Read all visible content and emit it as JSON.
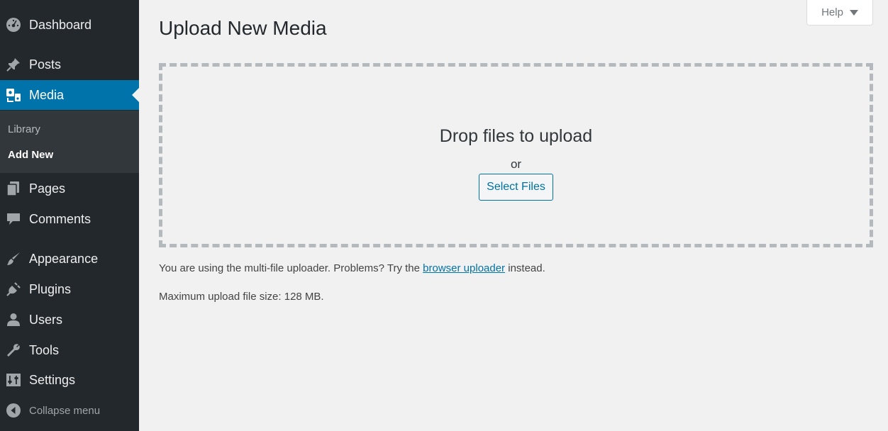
{
  "sidebar": {
    "items": [
      {
        "label": "Dashboard",
        "icon": "dashboard-icon"
      },
      {
        "label": "Posts",
        "icon": "pushpin-icon"
      },
      {
        "label": "Media",
        "icon": "media-icon"
      },
      {
        "label": "Pages",
        "icon": "pages-icon"
      },
      {
        "label": "Comments",
        "icon": "comment-icon"
      },
      {
        "label": "Appearance",
        "icon": "paintbrush-icon"
      },
      {
        "label": "Plugins",
        "icon": "plug-icon"
      },
      {
        "label": "Users",
        "icon": "user-icon"
      },
      {
        "label": "Tools",
        "icon": "wrench-icon"
      },
      {
        "label": "Settings",
        "icon": "settings-sliders-icon"
      }
    ],
    "submenu": [
      {
        "label": "Library"
      },
      {
        "label": "Add New"
      }
    ],
    "collapse_label": "Collapse menu",
    "current": "Media",
    "current_sub": "Add New"
  },
  "help_tab": {
    "label": "Help"
  },
  "main": {
    "title": "Upload New Media",
    "drop_area": {
      "instructions": "Drop files to upload",
      "or": "or",
      "button": "Select Files"
    },
    "notes": {
      "uploader_prefix": "You are using the multi-file uploader. Problems? Try the ",
      "uploader_link": "browser uploader",
      "uploader_suffix": " instead.",
      "max_size": "Maximum upload file size: 128 MB."
    }
  },
  "colors": {
    "sidebar_bg": "#23282d",
    "submenu_bg": "#32373c",
    "accent": "#0073aa",
    "page_bg": "#f1f1f1"
  }
}
